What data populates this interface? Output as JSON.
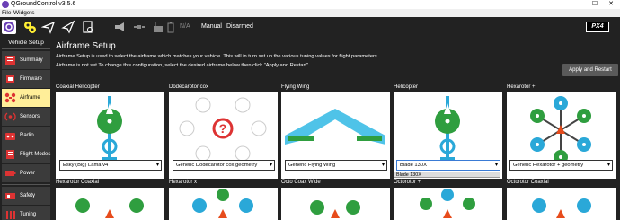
{
  "window": {
    "title": "QGroundControl v3.5.6",
    "minimize": "—",
    "maximize": "☐",
    "close": "✕"
  },
  "menu": [
    "File",
    "Widgets"
  ],
  "toolbar": {
    "battery_text": "N/A",
    "flight_mode": "Manual",
    "arm_state": "Disarmed",
    "brand": "PX4"
  },
  "sidebar": {
    "heading": "Vehicle Setup",
    "items": [
      {
        "label": "Summary",
        "icon": "summary-icon",
        "active": false
      },
      {
        "label": "Firmware",
        "icon": "firmware-icon",
        "active": false
      },
      {
        "label": "Airframe",
        "icon": "airframe-icon",
        "active": true
      },
      {
        "label": "Sensors",
        "icon": "sensors-icon",
        "active": false
      },
      {
        "label": "Radio",
        "icon": "radio-icon",
        "active": false
      },
      {
        "label": "Flight Modes",
        "icon": "flight-modes-icon",
        "active": false
      },
      {
        "label": "Power",
        "icon": "power-icon",
        "active": false
      },
      {
        "label": "Safety",
        "icon": "safety-icon",
        "active": false
      },
      {
        "label": "Tuning",
        "icon": "tuning-icon",
        "active": false
      }
    ]
  },
  "page": {
    "title": "Airframe Setup",
    "description_1": "Airframe Setup is used to select the airframe which matches your vehicle. This will in turn set up the various tuning values for flight parameters.",
    "description_2": "Airframe is not set.To change this configuration, select the desired airframe below then click \"Apply and Restart\".",
    "apply_button": "Apply and Restart"
  },
  "airframes_row1": [
    {
      "name": "Coaxial Helicopter",
      "selection": "Esky (Big) Lama v4",
      "kind": "coax-heli"
    },
    {
      "name": "Dodecarotor cox",
      "selection": "Generic Dodecarotor cox geometry",
      "kind": "unknown"
    },
    {
      "name": "Flying Wing",
      "selection": "Generic Flying Wing",
      "kind": "wing"
    },
    {
      "name": "Helicopter",
      "selection": "Blade 130X",
      "kind": "heli"
    },
    {
      "name": "Hexarotor +",
      "selection": "Generic Hexarotor + geometry",
      "kind": "hex"
    }
  ],
  "popup_option": "Blade 130X",
  "airframes_row2": [
    {
      "name": "Hexarotor Coaxial"
    },
    {
      "name": "Hexarotor x"
    },
    {
      "name": "Octo Coax Wide"
    },
    {
      "name": "Octorotor +"
    },
    {
      "name": "Octorotor Coaxial"
    }
  ],
  "colors": {
    "accent": "#ffee99",
    "blue_rotor": "#2aa8d8",
    "green_rotor": "#2f9e3f",
    "wing": "#4fc3e8",
    "body": "#222222"
  }
}
